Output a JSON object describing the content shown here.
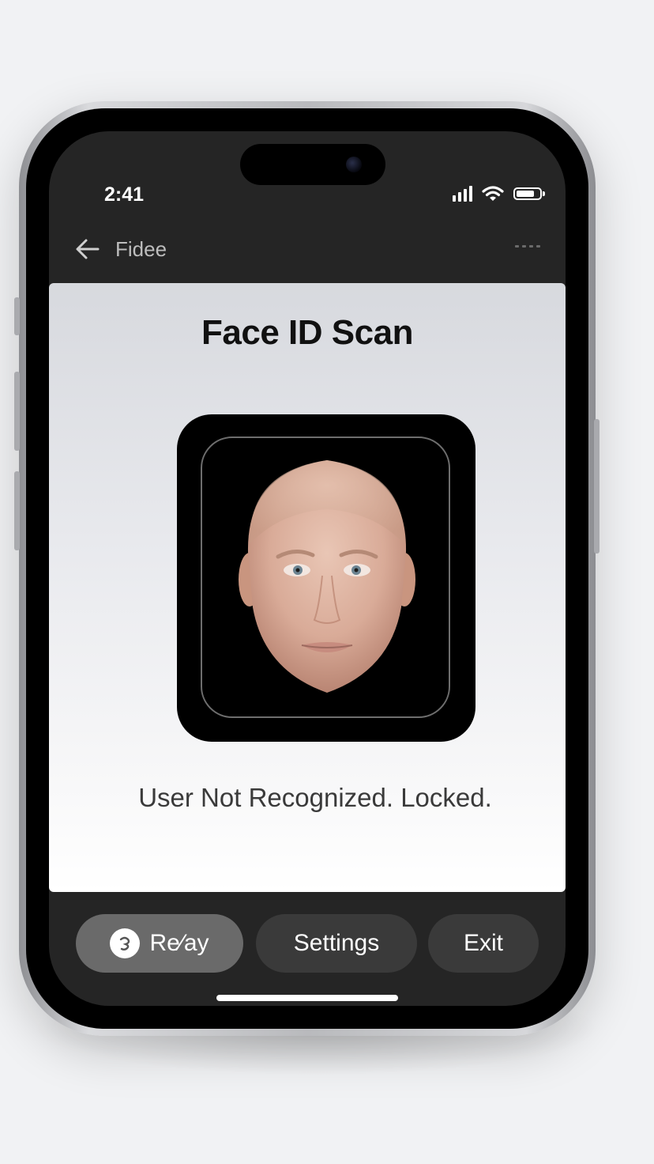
{
  "status_bar": {
    "time": "2:41",
    "icons": [
      "signal-icon",
      "wifi-icon",
      "battery-icon"
    ]
  },
  "nav": {
    "back_icon": "arrow-left-icon",
    "title": "Fidee",
    "more_icon": "more-dots-icon"
  },
  "card": {
    "title": "Face ID Scan",
    "status_message": "User Not Recognized. Locked."
  },
  "actions": {
    "replay_label": "Re⁄ay",
    "settings_label": "Settings",
    "exit_label": "Exit"
  },
  "colors": {
    "screen_background": "#252525",
    "card_top": "#d7d9de",
    "card_bottom": "#ffffff",
    "pill_active": "#6a6a6a",
    "pill_default": "#3a3a3a"
  }
}
